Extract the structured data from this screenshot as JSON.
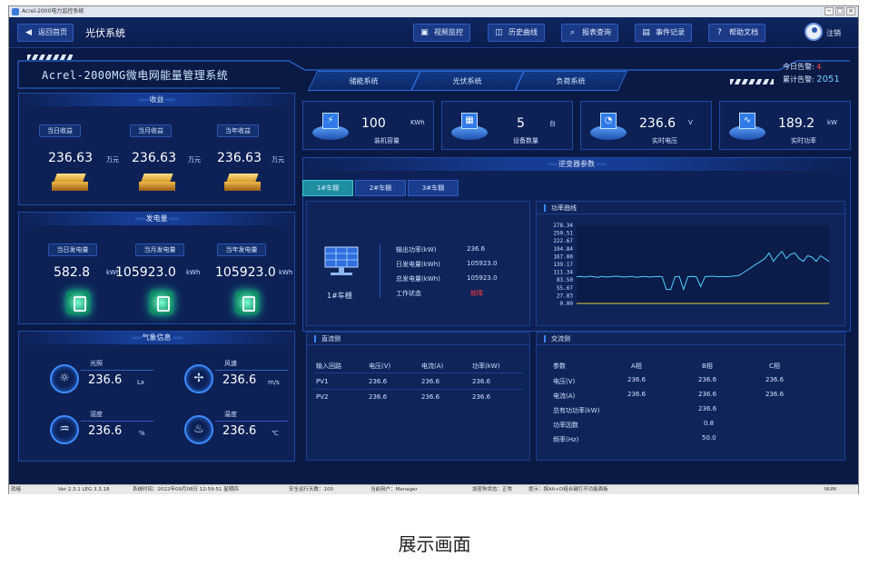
{
  "window": {
    "title": "Acrel-2000电力监控系统",
    "btn_min": "−",
    "btn_max": "□",
    "btn_close": "×"
  },
  "topnav": {
    "back_label": "返回首页",
    "page_title": "光伏系统",
    "buttons": [
      "视频监控",
      "历史曲线",
      "报表查询",
      "事件记录",
      "帮助文档"
    ],
    "logout": "注销"
  },
  "banner": {
    "system_title": "Acrel-2000MG微电网能量管理系统",
    "tabs": [
      "储能系统",
      "光伏系统",
      "负荷系统"
    ],
    "alarm_today_label": "今日告警:",
    "alarm_today_value": "4",
    "alarm_total_label": "累计告警:",
    "alarm_total_value": "2051"
  },
  "income": {
    "title": "收益",
    "items": [
      {
        "label": "当日收益",
        "value": "236.63",
        "unit": "万元"
      },
      {
        "label": "当月收益",
        "value": "236.63",
        "unit": "万元"
      },
      {
        "label": "当年收益",
        "value": "236.63",
        "unit": "万元"
      }
    ]
  },
  "generation": {
    "title": "发电量",
    "items": [
      {
        "label": "当日发电量",
        "value": "582.8",
        "unit": "kWh"
      },
      {
        "label": "当月发电量",
        "value": "105923.0",
        "unit": "kWh"
      },
      {
        "label": "当年发电量",
        "value": "105923.0",
        "unit": "kWh"
      }
    ]
  },
  "weather": {
    "title": "气象信息",
    "items": [
      {
        "label": "光照",
        "value": "236.6",
        "unit": "Lx"
      },
      {
        "label": "风速",
        "value": "236.6",
        "unit": "m/s"
      },
      {
        "label": "湿度",
        "value": "236.6",
        "unit": "%"
      },
      {
        "label": "温度",
        "value": "236.6",
        "unit": "℃"
      }
    ]
  },
  "cards": [
    {
      "value": "100",
      "unit": "KWh",
      "label": "装机容量"
    },
    {
      "value": "5",
      "unit": "台",
      "label": "设备数量"
    },
    {
      "value": "236.6",
      "unit": "V",
      "label": "实时电压"
    },
    {
      "value": "189.2",
      "unit": "kW",
      "label": "实时功率"
    }
  ],
  "inverter": {
    "title": "逆变器参数",
    "tabs": [
      "1#车棚",
      "2#车棚",
      "3#车棚"
    ],
    "name": "1#车棚",
    "params": [
      {
        "label": "输出功率(kW)",
        "value": "236.6"
      },
      {
        "label": "日发电量(kWh)",
        "value": "105923.0"
      },
      {
        "label": "总发电量(kWh)",
        "value": "105923.0"
      },
      {
        "label": "工作状态",
        "value": "故障"
      }
    ],
    "status_color": "#ff3b3b"
  },
  "chart_data": {
    "type": "line",
    "title": "功率曲线",
    "yticks": [
      "278.34",
      "250.51",
      "222.67",
      "194.84",
      "167.00",
      "139.17",
      "111.34",
      "83.50",
      "55.67",
      "27.83",
      "0.00"
    ],
    "ylim": [
      0,
      278.34
    ],
    "x": [
      0,
      1,
      2,
      3,
      4,
      5,
      6,
      7,
      8,
      9,
      10,
      11,
      12,
      13,
      14,
      15,
      16,
      17,
      18,
      19,
      20,
      21,
      22,
      23,
      24,
      25,
      26,
      27,
      28,
      29,
      30,
      31,
      32,
      33,
      34,
      35,
      36,
      37,
      38,
      39,
      40,
      41,
      42,
      43,
      44,
      45,
      46,
      47,
      48,
      49,
      50,
      51,
      52,
      53,
      54,
      55,
      56,
      57,
      58,
      59
    ],
    "series": [
      {
        "values": [
          95,
          96,
          94,
          97,
          95,
          93,
          96,
          94,
          95,
          97,
          96,
          94,
          95,
          96,
          93,
          95,
          96,
          94,
          95,
          96,
          95,
          50,
          50,
          95,
          96,
          50,
          95,
          96,
          95,
          60,
          95,
          96,
          97,
          95,
          96,
          95,
          96,
          98,
          100,
          110,
          120,
          130,
          140,
          150,
          160,
          180,
          150,
          170,
          185,
          160,
          175,
          180,
          160,
          150,
          170,
          165,
          150,
          170,
          160,
          150
        ]
      }
    ]
  },
  "dc": {
    "title": "直流侧",
    "headers": [
      "输入回路",
      "电压(V)",
      "电流(A)",
      "功率(kW)"
    ],
    "rows": [
      [
        "PV1",
        "236.6",
        "236.6",
        "236.6"
      ],
      [
        "PV2",
        "236.6",
        "236.6",
        "236.6"
      ]
    ]
  },
  "ac": {
    "title": "交流侧",
    "headers": [
      "参数",
      "A相",
      "B相",
      "C相"
    ],
    "rows": [
      [
        "电压(V)",
        "236.6",
        "236.6",
        "236.6"
      ],
      [
        "电流(A)",
        "236.6",
        "236.6",
        "236.6"
      ],
      [
        "总有功功率(kW)",
        "",
        "236.6",
        ""
      ],
      [
        "功率因数",
        "",
        "0.8",
        ""
      ],
      [
        "频率(Hz)",
        "",
        "50.0",
        ""
      ]
    ]
  },
  "statusbar": {
    "items": [
      "就绪",
      "Ver 2.3.1 LEG 3.3.18",
      "系统时间：2022年09月08日  12:59:51  星期四",
      "安全运行天数：100",
      "当前用户：Manager",
      "加密狗状态：正常",
      "提示：按Alt+D组合键打开功能面板",
      "NUM"
    ]
  },
  "caption": "展示画面"
}
